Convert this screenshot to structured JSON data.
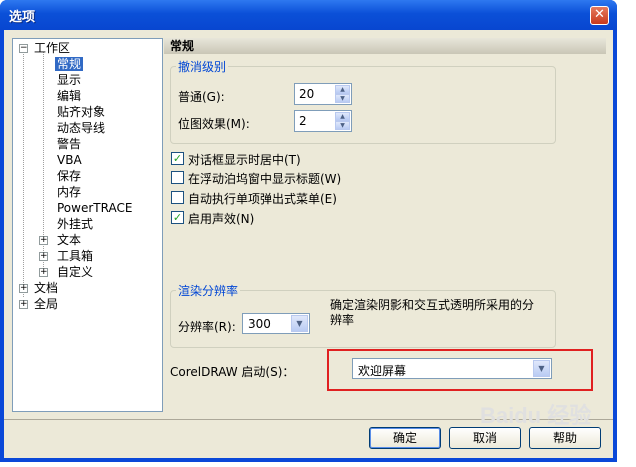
{
  "window": {
    "title": "选项",
    "close_icon": "close-icon"
  },
  "tree": {
    "items": [
      {
        "label": "工作区",
        "expander": "⊟"
      },
      {
        "label": "常规",
        "selected": true
      },
      {
        "label": "显示"
      },
      {
        "label": "编辑"
      },
      {
        "label": "贴齐对象"
      },
      {
        "label": "动态导线"
      },
      {
        "label": "警告"
      },
      {
        "label": "VBA"
      },
      {
        "label": "保存"
      },
      {
        "label": "内存"
      },
      {
        "label": "PowerTRACE"
      },
      {
        "label": "外挂式"
      },
      {
        "label": "文本",
        "expander": "+"
      },
      {
        "label": "工具箱",
        "expander": "+"
      },
      {
        "label": "自定义",
        "expander": "+"
      },
      {
        "label": "文档",
        "expander": "+"
      },
      {
        "label": "全局",
        "expander": "+"
      }
    ]
  },
  "panel": {
    "header": "常规",
    "undo": {
      "legend": "撤消级别",
      "normal_label": "普通(G):",
      "normal_value": "20",
      "bitmap_label": "位图效果(M):",
      "bitmap_value": "2"
    },
    "checkboxes": [
      {
        "label": "对话框显示时居中(T)",
        "checked": true
      },
      {
        "label": "在浮动泊坞窗中显示标题(W)",
        "checked": false
      },
      {
        "label": "自动执行单项弹出式菜单(E)",
        "checked": false
      },
      {
        "label": "启用声效(N)",
        "checked": true
      }
    ],
    "render": {
      "legend": "渲染分辨率",
      "resolution_label": "分辨率(R):",
      "resolution_value": "300",
      "description": "确定渲染阴影和交互式透明所采用的分辨率"
    },
    "startup": {
      "label": "CorelDRAW 启动(S)：",
      "value": "欢迎屏幕"
    }
  },
  "buttons": {
    "ok": "确定",
    "cancel": "取消",
    "help": "帮助"
  },
  "watermark": "Baidu 经验",
  "colors": {
    "titlebar": "#0b50d8",
    "selection": "#316ac5",
    "highlight_box": "#e02020",
    "legend_text": "#0046d5"
  }
}
